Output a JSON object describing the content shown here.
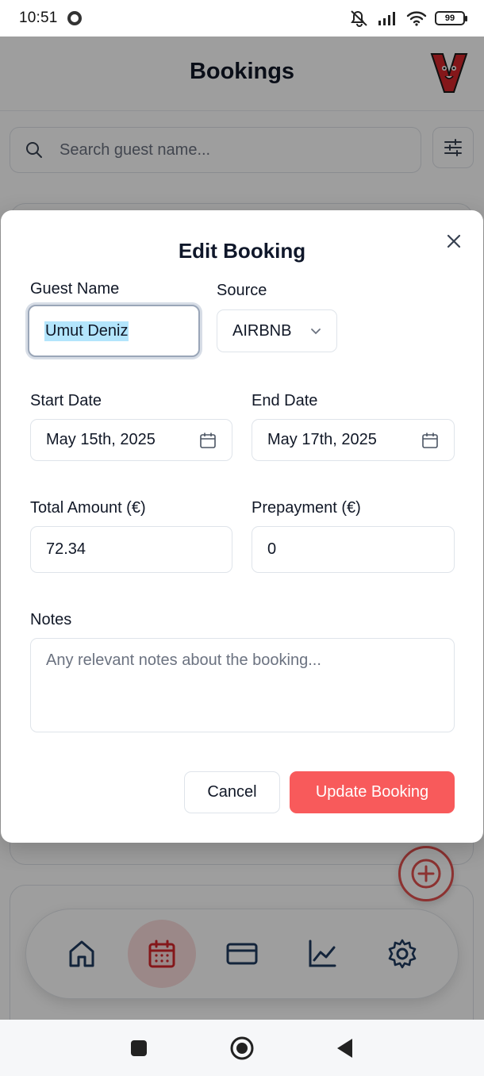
{
  "status_bar": {
    "time": "10:51",
    "battery": "99"
  },
  "header": {
    "title": "Bookings"
  },
  "search": {
    "placeholder": "Search guest name..."
  },
  "modal": {
    "title": "Edit Booking",
    "guest_name": {
      "label": "Guest Name",
      "value": "Umut Deniz"
    },
    "source": {
      "label": "Source",
      "value": "AIRBNB"
    },
    "start_date": {
      "label": "Start Date",
      "value": "May 15th, 2025"
    },
    "end_date": {
      "label": "End Date",
      "value": "May 17th, 2025"
    },
    "total_amount": {
      "label": "Total Amount (€)",
      "value": "72.34"
    },
    "prepayment": {
      "label": "Prepayment (€)",
      "value": "0"
    },
    "notes": {
      "label": "Notes",
      "placeholder": "Any relevant notes about the booking..."
    },
    "cancel_label": "Cancel",
    "update_label": "Update Booking"
  },
  "bottom_nav": {
    "items": [
      {
        "icon": "home-icon",
        "active": false
      },
      {
        "icon": "calendar-icon",
        "active": true
      },
      {
        "icon": "credit-card-icon",
        "active": false
      },
      {
        "icon": "chart-line-icon",
        "active": false
      },
      {
        "icon": "gear-icon",
        "active": false
      }
    ]
  },
  "colors": {
    "accent": "#f85a5b",
    "nav_active_bg": "#fbdcdc",
    "selection": "#b3e5fc"
  }
}
